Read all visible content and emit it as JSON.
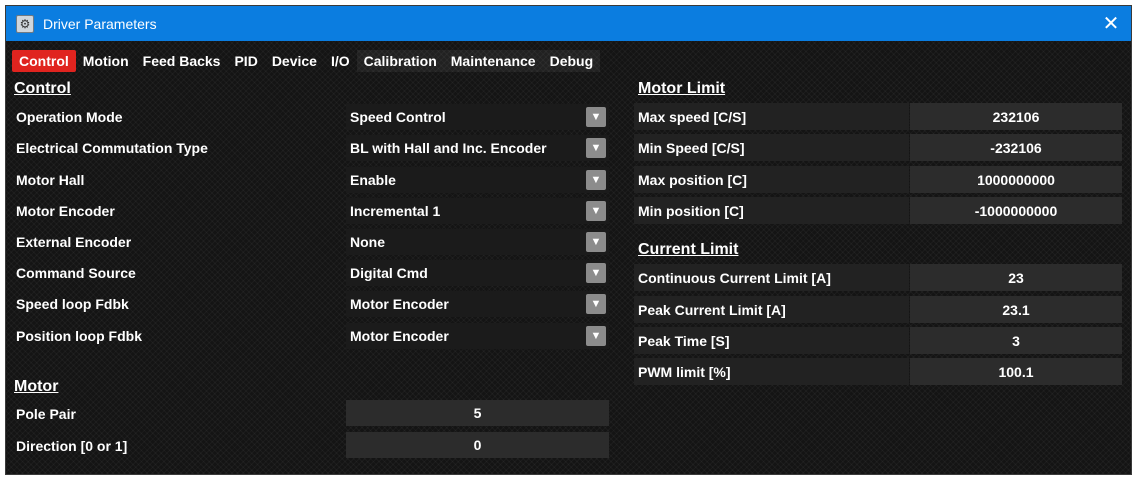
{
  "window": {
    "title": "Driver Parameters",
    "close_glyph": "✕",
    "icon_name": "app-gear-icon"
  },
  "tabs": [
    {
      "label": "Control",
      "active": true
    },
    {
      "label": "Motion"
    },
    {
      "label": "Feed Backs"
    },
    {
      "label": "PID"
    },
    {
      "label": "Device"
    },
    {
      "label": "I/O"
    },
    {
      "label": "Calibration"
    },
    {
      "label": "Maintenance"
    },
    {
      "label": "Debug"
    }
  ],
  "control": {
    "title": "Control",
    "rows": [
      {
        "label": "Operation Mode",
        "value": "Speed Control"
      },
      {
        "label": "Electrical Commutation Type",
        "value": "BL with Hall and Inc. Encoder"
      },
      {
        "label": "Motor Hall",
        "value": "Enable"
      },
      {
        "label": "Motor Encoder",
        "value": "Incremental 1"
      },
      {
        "label": "External Encoder",
        "value": "None"
      },
      {
        "label": "Command Source",
        "value": "Digital Cmd"
      },
      {
        "label": "Speed loop Fdbk",
        "value": "Motor Encoder"
      },
      {
        "label": "Position loop Fdbk",
        "value": "Motor Encoder"
      }
    ]
  },
  "motor": {
    "title": "Motor",
    "rows": [
      {
        "label": "Pole Pair",
        "value": "5"
      },
      {
        "label": "Direction [0 or 1]",
        "value": "0"
      }
    ]
  },
  "motor_limit": {
    "title": "Motor Limit",
    "rows": [
      {
        "label": "Max speed [C/S]",
        "value": "232106"
      },
      {
        "label": "Min Speed [C/S]",
        "value": "-232106"
      },
      {
        "label": "Max position [C]",
        "value": "1000000000"
      },
      {
        "label": "Min position [C]",
        "value": "-1000000000"
      }
    ]
  },
  "current_limit": {
    "title": "Current Limit",
    "rows": [
      {
        "label": "Continuous Current Limit [A]",
        "value": "23"
      },
      {
        "label": "Peak Current Limit [A]",
        "value": "23.1"
      },
      {
        "label": "Peak Time [S]",
        "value": "3"
      },
      {
        "label": "PWM limit [%]",
        "value": "100.1"
      }
    ]
  },
  "colors": {
    "titlebar": "#0b7de0",
    "active_tab": "#e0241f",
    "background": "#141414",
    "field": "#2c2c2c"
  }
}
